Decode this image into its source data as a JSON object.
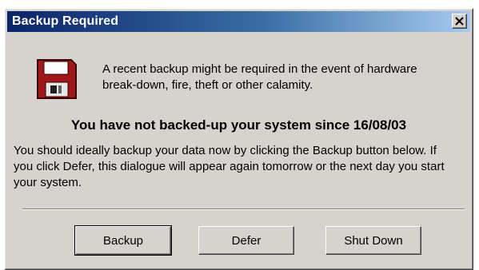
{
  "window": {
    "title": "Backup Required",
    "close_glyph": "✕"
  },
  "icon": {
    "name": "floppy-disk-icon",
    "body_color": "#a01818",
    "label_color": "#ffffff"
  },
  "message": {
    "intro": "A recent backup might be required in the event of hardware break-down, fire, theft or other calamity.",
    "warning": "You have not backed-up your system since 16/08/03",
    "body": "You should ideally backup your data now by clicking the Backup button below. If you click Defer, this dialogue will appear again tomorrow or the next day you start your system."
  },
  "buttons": {
    "backup": "Backup",
    "defer": "Defer",
    "shutdown": "Shut Down"
  },
  "colors": {
    "dialog_face": "#d6d3ce",
    "title_gradient_start": "#0a246a",
    "title_gradient_end": "#a6caf0"
  }
}
